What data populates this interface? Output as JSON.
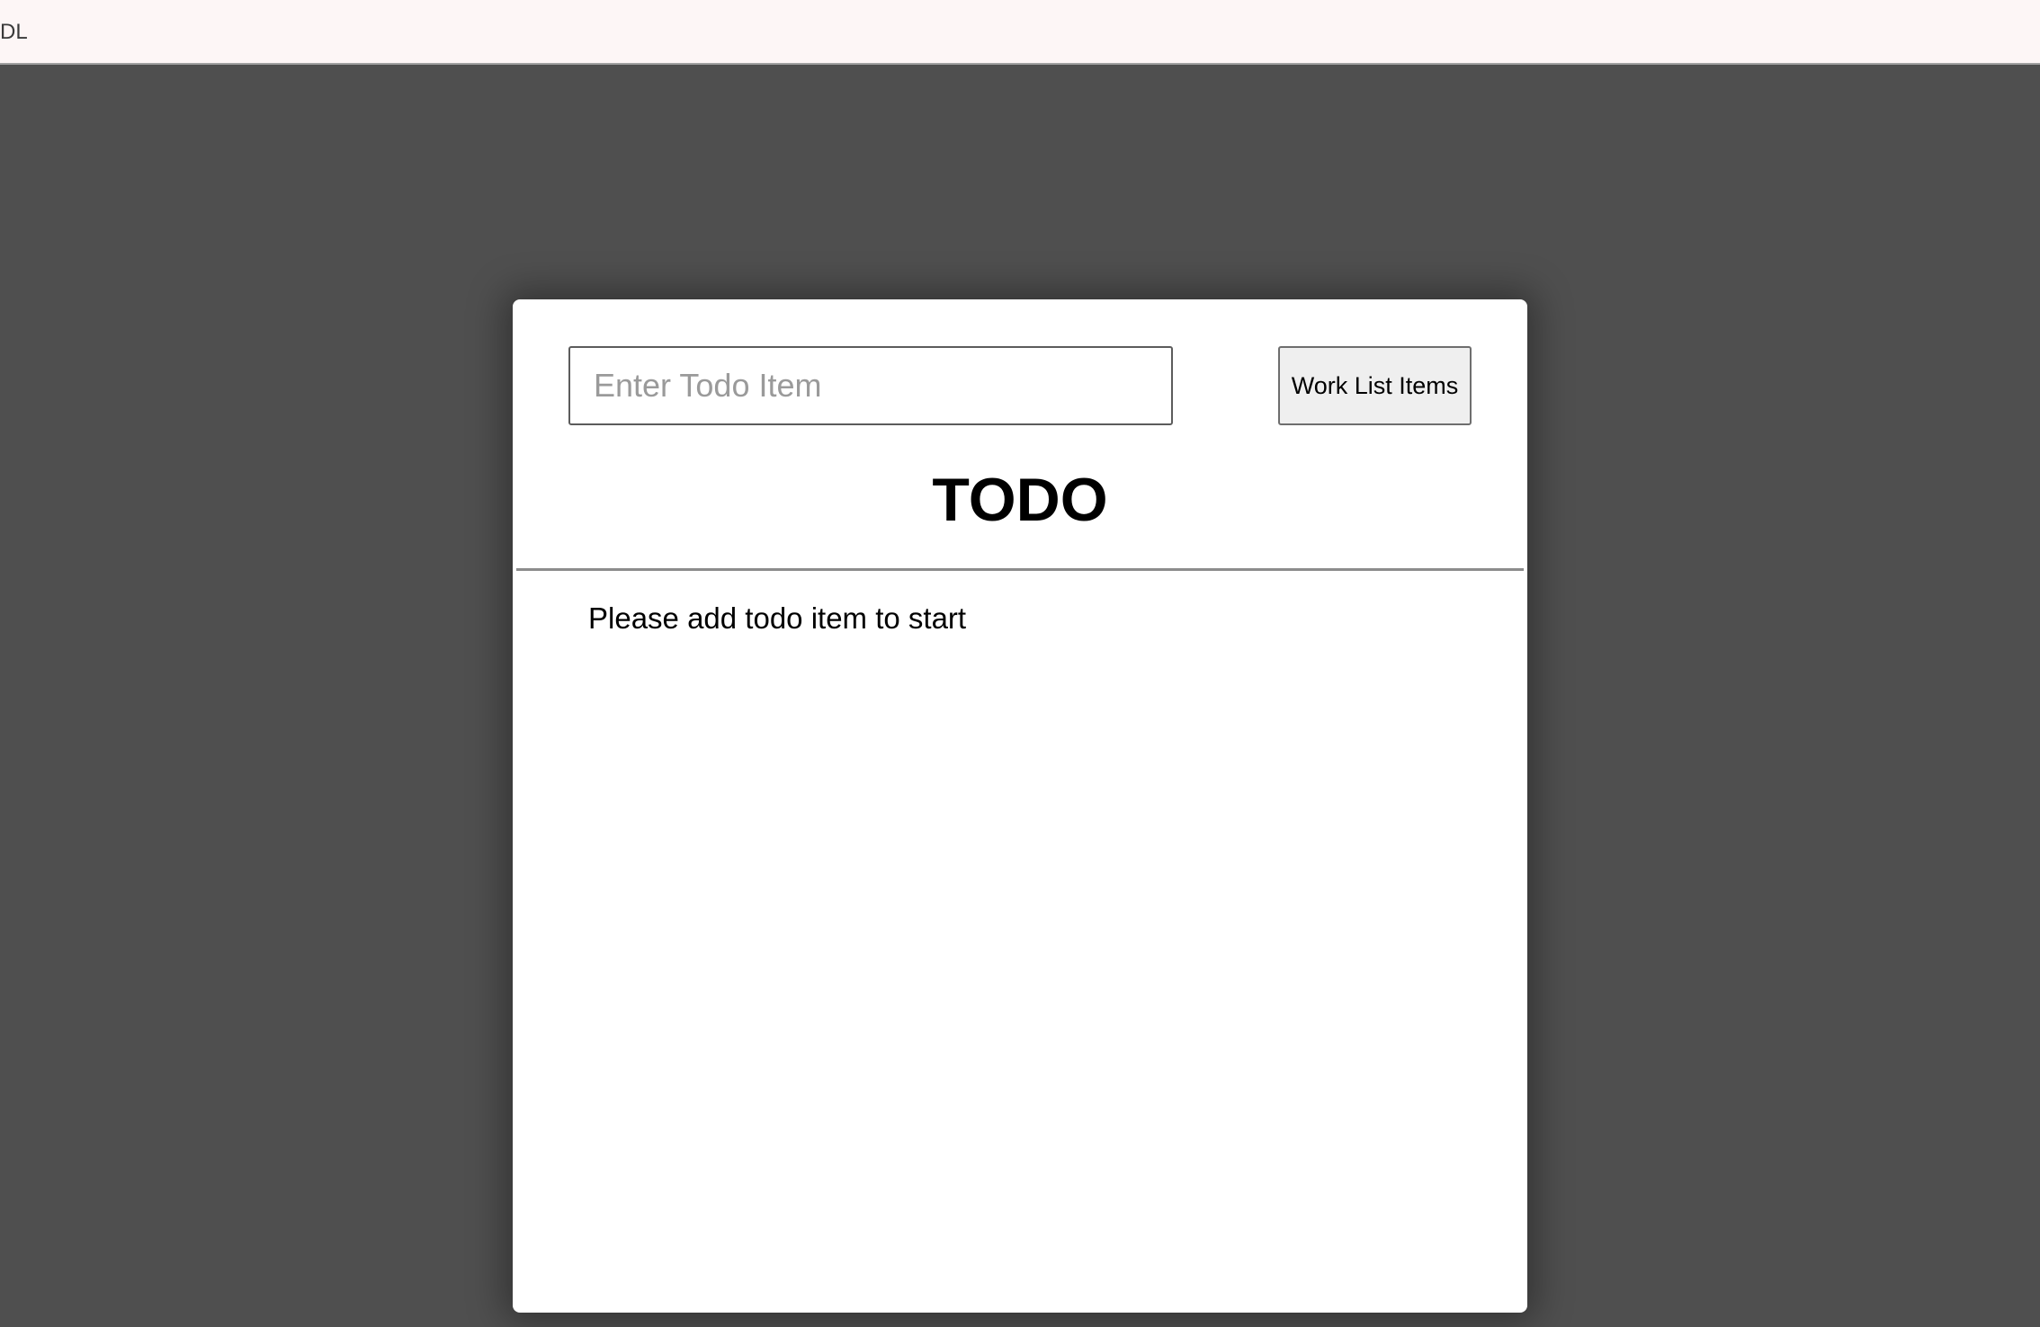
{
  "topbar": {
    "text": "DL"
  },
  "todo": {
    "input_placeholder": "Enter Todo Item",
    "input_value": "",
    "work_button_label": "Work List Items",
    "title": "TODO",
    "empty_message": "Please add todo item to start"
  },
  "colors": {
    "page_background": "#4f4f4f",
    "topbar_background": "#fdf6f6",
    "card_background": "#ffffff",
    "button_background": "#efefef"
  }
}
